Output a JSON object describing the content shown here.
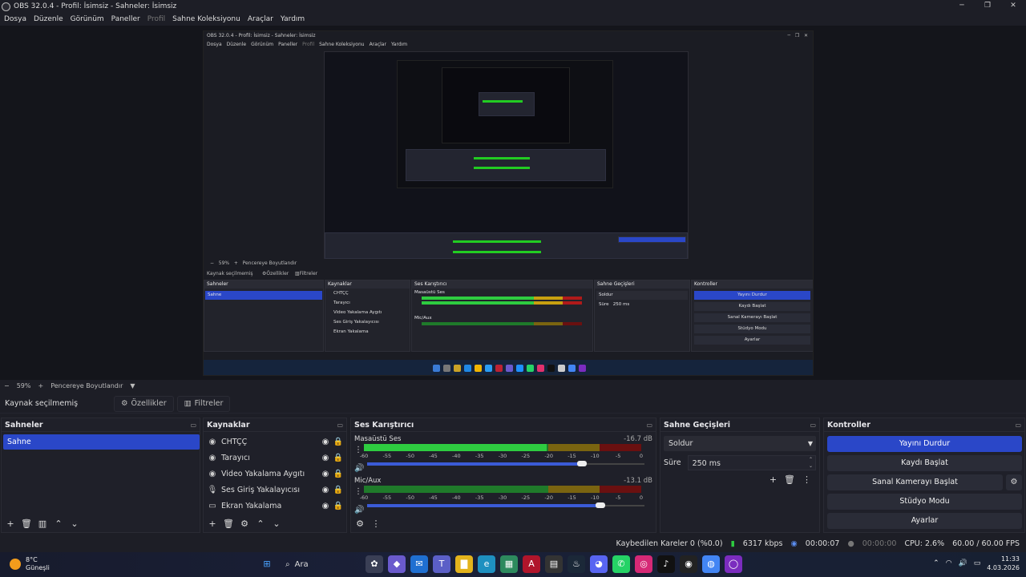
{
  "window": {
    "title": "OBS 32.0.4 - Profil: İsimsiz - Sahneler: İsimsiz"
  },
  "menu": {
    "items": [
      "Dosya",
      "Düzenle",
      "Görünüm",
      "Paneller",
      "Profil",
      "Sahne Koleksiyonu",
      "Araçlar",
      "Yardım"
    ]
  },
  "zoom": {
    "minus": "−",
    "value": "59%",
    "plus": "+",
    "fit_label": "Pencereye Boyutlandır"
  },
  "toolbar": {
    "no_source": "Kaynak seçilmemiş",
    "properties": "Özellikler",
    "filters": "Filtreler"
  },
  "scenes": {
    "title": "Sahneler",
    "items": [
      "Sahne"
    ]
  },
  "sources": {
    "title": "Kaynaklar",
    "items": [
      "CHTÇÇ",
      "Tarayıcı",
      "Video Yakalama Aygıtı",
      "Ses Giriş Yakalayıcısı",
      "Ekran Yakalama"
    ]
  },
  "mixer": {
    "title": "Ses Karıştırıcı",
    "ticks": [
      "-60",
      "-55",
      "-50",
      "-45",
      "-40",
      "-35",
      "-30",
      "-25",
      "-20",
      "-15",
      "-10",
      "-5",
      "0"
    ],
    "channels": [
      {
        "name": "Masaüstü Ses",
        "db": "-16.7 dB",
        "level": 0.66,
        "volume": 0.8
      },
      {
        "name": "Mic/Aux",
        "db": "-13.1 dB",
        "level": 0.0,
        "volume": 0.87
      }
    ]
  },
  "transitions": {
    "title": "Sahne Geçişleri",
    "selected": "Soldur",
    "duration_label": "Süre",
    "duration_value": "250 ms"
  },
  "controls": {
    "title": "Kontroller",
    "buttons": [
      "Yayını Durdur",
      "Kaydı Başlat",
      "Sanal Kamerayı Başlat",
      "Stüdyo Modu",
      "Ayarlar"
    ]
  },
  "status": {
    "dropped": "Kaybedilen Kareler 0 (%0.0)",
    "bitrate": "6317 kbps",
    "stream_time": "00:00:07",
    "rec_time": "00:00:00",
    "cpu": "CPU: 2.6%",
    "fps": "60.00 / 60.00 FPS"
  },
  "taskbar": {
    "temp": "8°C",
    "weather": "Güneşli",
    "search": "Ara",
    "time": "11:33",
    "date": "4.03.2026"
  },
  "colors": {
    "accent": "#2a47c8",
    "meter_green": "#2ecc40",
    "meter_yellow": "#c8a010",
    "meter_red": "#b01a1a"
  }
}
